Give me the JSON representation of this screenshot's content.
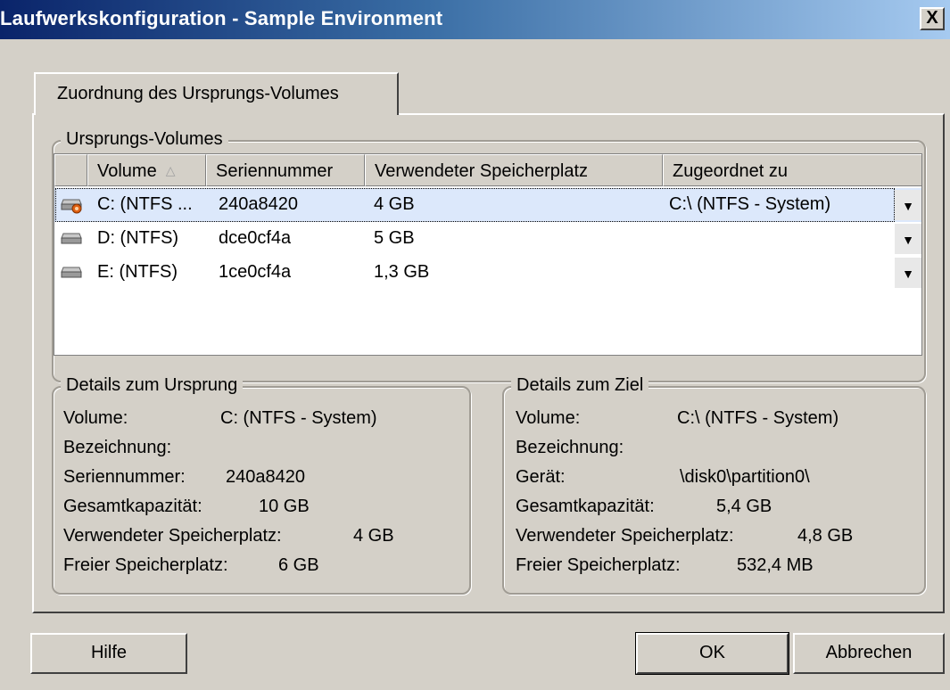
{
  "window": {
    "title": "Laufwerkskonfiguration - Sample Environment",
    "close_label": "X"
  },
  "tab": {
    "label": "Zuordnung des Ursprungs-Volumes"
  },
  "source_group": {
    "legend": "Ursprungs-Volumes",
    "columns": [
      "Volume",
      "Seriennummer",
      "Verwendeter Speicherplatz",
      "Zugeordnet zu"
    ],
    "sort_indicator": "△",
    "rows": [
      {
        "volume": "C:  (NTFS ...",
        "serial": "240a8420",
        "used": "4 GB",
        "mapped": "C:\\ (NTFS - System)",
        "icon": "system-disk-icon",
        "selected": true
      },
      {
        "volume": "D: (NTFS)",
        "serial": "dce0cf4a",
        "used": "5 GB",
        "mapped": "",
        "icon": "disk-icon",
        "selected": false
      },
      {
        "volume": "E: (NTFS)",
        "serial": "1ce0cf4a",
        "used": "1,3 GB",
        "mapped": "",
        "icon": "disk-icon",
        "selected": false
      }
    ]
  },
  "source_details": {
    "legend": "Details zum Ursprung",
    "lines": [
      {
        "label": "Volume:",
        "value": "C: (NTFS - System)"
      },
      {
        "label": "Bezeichnung:",
        "value": ""
      },
      {
        "label": "Seriennummer:",
        "value": "240a8420"
      },
      {
        "label": "Gesamtkapazität:",
        "value": "10 GB"
      },
      {
        "label": "Verwendeter Speicherplatz:",
        "value": "4 GB"
      },
      {
        "label": "Freier Speicherplatz:",
        "value": "6 GB"
      }
    ]
  },
  "target_details": {
    "legend": "Details zum Ziel",
    "lines": [
      {
        "label": "Volume:",
        "value": "C:\\ (NTFS - System)"
      },
      {
        "label": "Bezeichnung:",
        "value": ""
      },
      {
        "label": "Gerät:",
        "value": "\\disk0\\partition0\\"
      },
      {
        "label": "Gesamtkapazität:",
        "value": "5,4 GB"
      },
      {
        "label": "Verwendeter Speicherplatz:",
        "value": "4,8 GB"
      },
      {
        "label": "Freier Speicherplatz:",
        "value": "532,4 MB"
      }
    ]
  },
  "buttons": {
    "help": "Hilfe",
    "ok": "OK",
    "cancel": "Abbrechen"
  },
  "colors": {
    "selection": "#dce8fb",
    "titlebar_start": "#0a246a",
    "titlebar_end": "#a6caf0"
  }
}
